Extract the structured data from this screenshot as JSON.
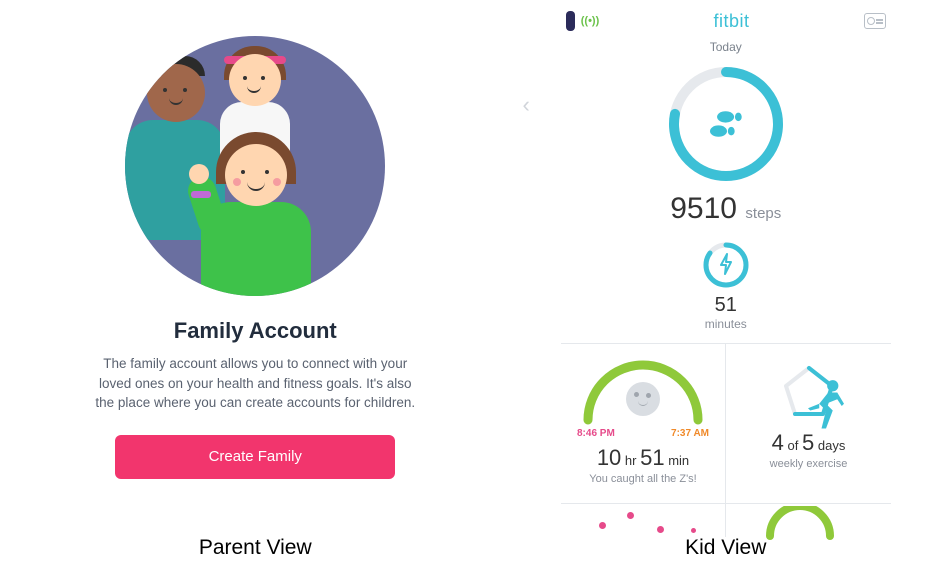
{
  "captions": {
    "parent": "Parent View",
    "kid": "Kid View"
  },
  "parent": {
    "title": "Family Account",
    "description": "The family account allows you to connect with your loved ones on your health and fitness goals. It's also the place where you can create accounts for children.",
    "create_button": "Create Family"
  },
  "kid": {
    "brand": "fitbit",
    "sync_label": "((•))",
    "date_label": "Today",
    "steps": {
      "value": "9510",
      "label": "steps",
      "progress": 0.78
    },
    "active_minutes": {
      "value": "51",
      "label": "minutes",
      "progress": 0.85
    },
    "sleep": {
      "bedtime": "8:46 PM",
      "waketime": "7:37 AM",
      "hours": "10",
      "hours_label": "hr",
      "minutes": "51",
      "minutes_label": "min",
      "message": "You caught all the Z's!"
    },
    "exercise": {
      "done": "4",
      "of_label": "of",
      "goal": "5",
      "goal_unit": "days",
      "label": "weekly exercise"
    }
  },
  "colors": {
    "accent_pink": "#f2356d",
    "accent_teal": "#3cc0d6",
    "accent_green": "#8fc93a"
  }
}
